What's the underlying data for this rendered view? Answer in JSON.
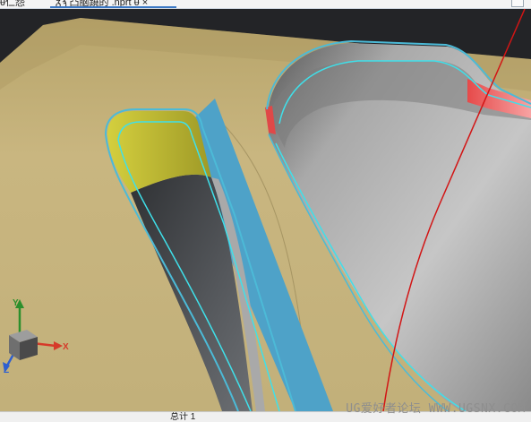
{
  "tabs": [
    {
      "label": "ᵾ仁怨",
      "active": false
    },
    {
      "label": "ᵹϡ 凸脑蹺的 .nprt ᵾ ×",
      "active": true
    }
  ],
  "triad": {
    "x_label": "X",
    "y_label": "Y",
    "z_label": "Z"
  },
  "status": {
    "text": "总计 1"
  },
  "watermark": {
    "text": "UG爱好者论坛 WWW.UGSNX.COM"
  },
  "colors": {
    "background_dark": "#232427",
    "body_tan": "#c8b57e",
    "slot_yellow": "#c7c03c",
    "slot_blue": "#4ea2c8",
    "highlight_cyan": "#3fe0ea",
    "red_curve": "#d21515",
    "pocket_gray": "#9e9e9e",
    "tab_accent": "#3b78c4"
  }
}
